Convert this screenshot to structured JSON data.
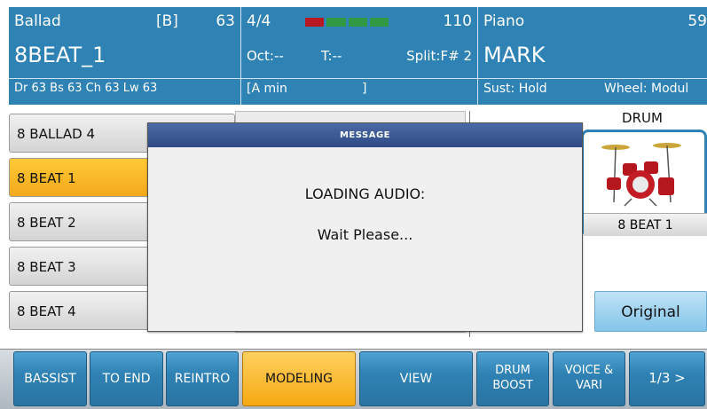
{
  "header": {
    "style": {
      "category": "Ballad",
      "bank": "[B]",
      "number": "63",
      "name": "8BEAT_1",
      "volumes": "Dr 63  Bs 63  Ch 63  Lw 63"
    },
    "mid": {
      "time_signature": "4/4",
      "tempo": "110",
      "octave": "Oct:--",
      "transpose": "T:--",
      "split": "Split:F# 2",
      "chord": "[A min",
      "chord_close": "]"
    },
    "voice": {
      "category": "Piano",
      "number": "59",
      "name": "MARK",
      "sustain": "Sust: Hold",
      "wheel": "Wheel: Modul"
    }
  },
  "style_list": [
    "8 BALLAD 4",
    "8 BEAT 1",
    "8 BEAT 2",
    "8 BEAT 3",
    "8 BEAT 4"
  ],
  "drum": {
    "title": "DRUM",
    "name": "8 BEAT 1"
  },
  "original_label": "Original",
  "modal": {
    "title": "MESSAGE",
    "line1": "LOADING AUDIO:",
    "line2": "Wait Please..."
  },
  "tabs": {
    "bassist": "BASSIST",
    "to_end": "TO END",
    "reintro": "REINTRO",
    "modeling": "MODELING",
    "view": "VIEW",
    "drum_boost_1": "DRUM",
    "drum_boost_2": "BOOST",
    "voice_vari_1": "VOICE &",
    "voice_vari_2": "VARI",
    "page": "1/3 >"
  },
  "colors": {
    "header_blue": "#2f82b4",
    "selected_orange": "#f3a91b",
    "tempo_red": "#b81822",
    "tempo_green": "#2f9a43"
  }
}
